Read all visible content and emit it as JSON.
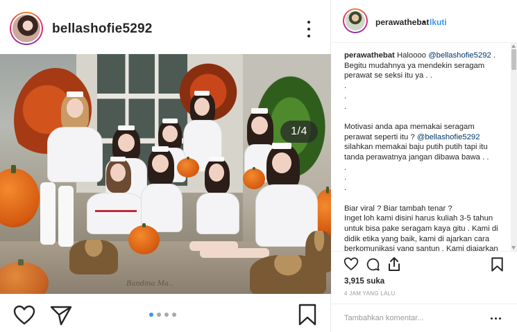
{
  "left_post": {
    "username": "bellashofie5292",
    "image_counter": "1/4",
    "signature": "Bandma Ma..",
    "carousel_dots": 4,
    "carousel_active_index": 0
  },
  "right_panel": {
    "username": "perawathebat",
    "separator": "•",
    "follow_label": "Ikuti",
    "caption": {
      "author": "perawathebat",
      "blocks": [
        {
          "type": "mixed",
          "parts": [
            {
              "t": "Haloooo "
            },
            {
              "t": "@bellashofie5292",
              "mention": true
            },
            {
              "t": " . Begitu mudahnya ya mendekin seragam perawat se seksi itu ya . ."
            }
          ]
        },
        {
          "type": "text",
          "text": "."
        },
        {
          "type": "text",
          "text": "."
        },
        {
          "type": "text",
          "text": "."
        },
        {
          "type": "mixed",
          "parts": [
            {
              "t": "Motivasi anda apa memakai seragam perawat seperti itu ? "
            },
            {
              "t": "@bellashofie5292",
              "mention": true
            },
            {
              "t": " silahkan memakai baju putih putih tapi itu tanda perawatnya jangan dibawa bawa . ."
            }
          ]
        },
        {
          "type": "text",
          "text": "."
        },
        {
          "type": "text",
          "text": "."
        },
        {
          "type": "text",
          "text": "."
        },
        {
          "type": "text",
          "text": "Biar viral ? Biar tambah tenar ?"
        },
        {
          "type": "text",
          "text": "Inget loh kami disini harus kuliah 3-5 tahun untuk bisa pake seragam kaya gitu . Kami di didik etika yang baik, kami di ajarkan cara berkomunikasi yang santun . Kami diajarkan untuk saling menghargai satu sama lain . Betapa sakitnya perawat"
        }
      ]
    },
    "likes": "3,915 suka",
    "time_ago": "4 JAM YANG LALU",
    "comment_placeholder": "Tambahkan komentar..."
  },
  "colors": {
    "link_blue": "#3897f0",
    "mention_blue": "#003569",
    "text": "#262626",
    "muted": "#999999",
    "border": "#efefef"
  },
  "icons": {
    "left_actions": [
      "heart-icon",
      "send-icon",
      "bookmark-icon"
    ],
    "right_actions": [
      "heart-icon",
      "comment-icon",
      "share-icon",
      "bookmark-icon"
    ]
  }
}
